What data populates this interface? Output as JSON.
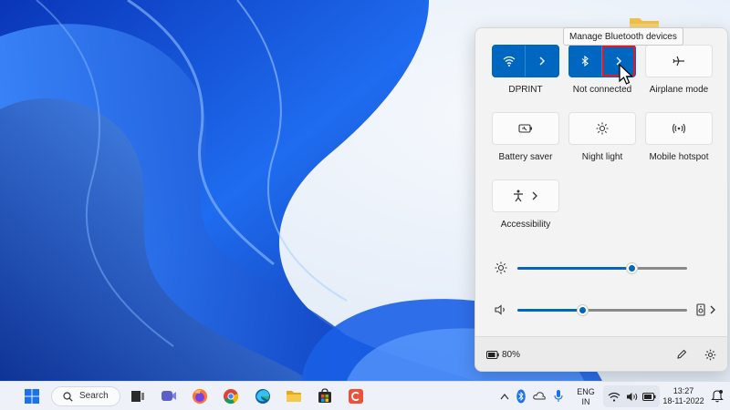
{
  "tooltip": "Manage Bluetooth devices",
  "quick_settings": {
    "tiles": [
      {
        "label": "DPRINT"
      },
      {
        "label": "Not connected"
      },
      {
        "label": "Airplane mode"
      },
      {
        "label": "Battery saver"
      },
      {
        "label": "Night light"
      },
      {
        "label": "Mobile hotspot"
      },
      {
        "label": "Accessibility"
      }
    ],
    "brightness_level": 0.67,
    "volume_level": 0.38,
    "battery_text": "80%"
  },
  "taskbar": {
    "search_label": "Search",
    "language": "ENG",
    "region": "IN",
    "time": "13:27",
    "date": "18-11-2022"
  },
  "colors": {
    "accent": "#0067c0",
    "highlight_outline": "#e3182a",
    "panel_bg": "#f3f3f3"
  },
  "icons": [
    "wifi-icon",
    "bluetooth-icon",
    "airplane-icon",
    "battery-saver-icon",
    "night-light-icon",
    "hotspot-icon",
    "accessibility-icon",
    "brightness-icon",
    "volume-icon",
    "device-select-icon",
    "battery-icon",
    "edit-icon",
    "settings-icon",
    "start-icon",
    "search-icon",
    "task-view-icon",
    "meet-icon",
    "firefox-icon",
    "chrome-icon",
    "edge-icon",
    "file-explorer-icon",
    "store-icon",
    "app-icon",
    "chevron-up-icon",
    "mic-icon",
    "notifications-icon"
  ]
}
